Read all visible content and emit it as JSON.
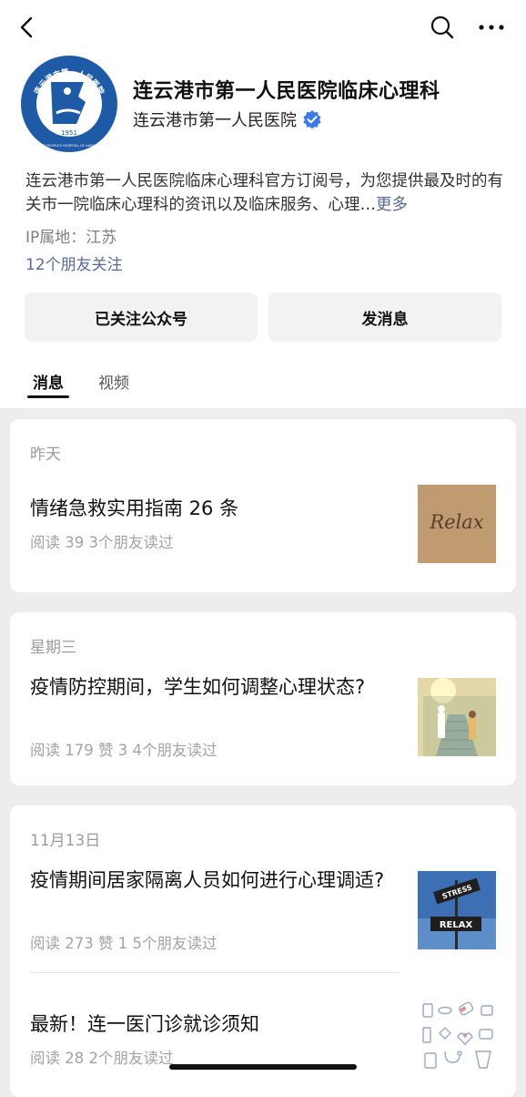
{
  "account": {
    "name": "连云港市第一人民医院临床心理科",
    "org": "连云港市第一人民医院",
    "logo": {
      "ring_text": "连云港市第一人民医院",
      "english_text": "THE FIRST PEOPLE'S HOSPITAL OF LIANYUNGANG",
      "year": "1951"
    },
    "description": "连云港市第一人民医院临床心理科官方订阅号，为您提供最及时的有关市一院临床心理科的资讯以及临床服务、心理…",
    "more_label": "更多",
    "ip_location": "IP属地：江苏",
    "friends_following": "12个朋友关注",
    "verified_icon": "verified-badge-icon"
  },
  "nav": {
    "back_icon": "back-arrow-icon",
    "search_icon": "search-icon",
    "more_icon": "more-dots-icon"
  },
  "buttons": {
    "follow_label": "已关注公众号",
    "message_label": "发消息"
  },
  "tabs": [
    {
      "label": "消息",
      "active": true
    },
    {
      "label": "视频",
      "active": false
    }
  ],
  "feed": [
    {
      "date": "昨天",
      "articles": [
        {
          "title": "情绪急救实用指南 26 条",
          "stats": "阅读 39   3个朋友读过",
          "thumb_text": "Relax"
        }
      ]
    },
    {
      "date": "星期三",
      "articles": [
        {
          "title": "疫情防控期间，学生如何调整心理状态?",
          "stats": "阅读 179   赞 3   4个朋友读过"
        }
      ]
    },
    {
      "date": "11月13日",
      "articles": [
        {
          "title": "疫情期间居家隔离人员如何进行心理调适?",
          "stats": "阅读 273   赞 1   5个朋友读过",
          "thumb_text_top": "STRESS",
          "thumb_text_bottom": "RELAX"
        },
        {
          "title": "最新！连一医门诊就诊须知",
          "stats": "阅读 28   2个朋友读过"
        }
      ]
    }
  ],
  "colors": {
    "link": "#576b95",
    "background": "#ededed",
    "verified": "#3d7be6"
  }
}
